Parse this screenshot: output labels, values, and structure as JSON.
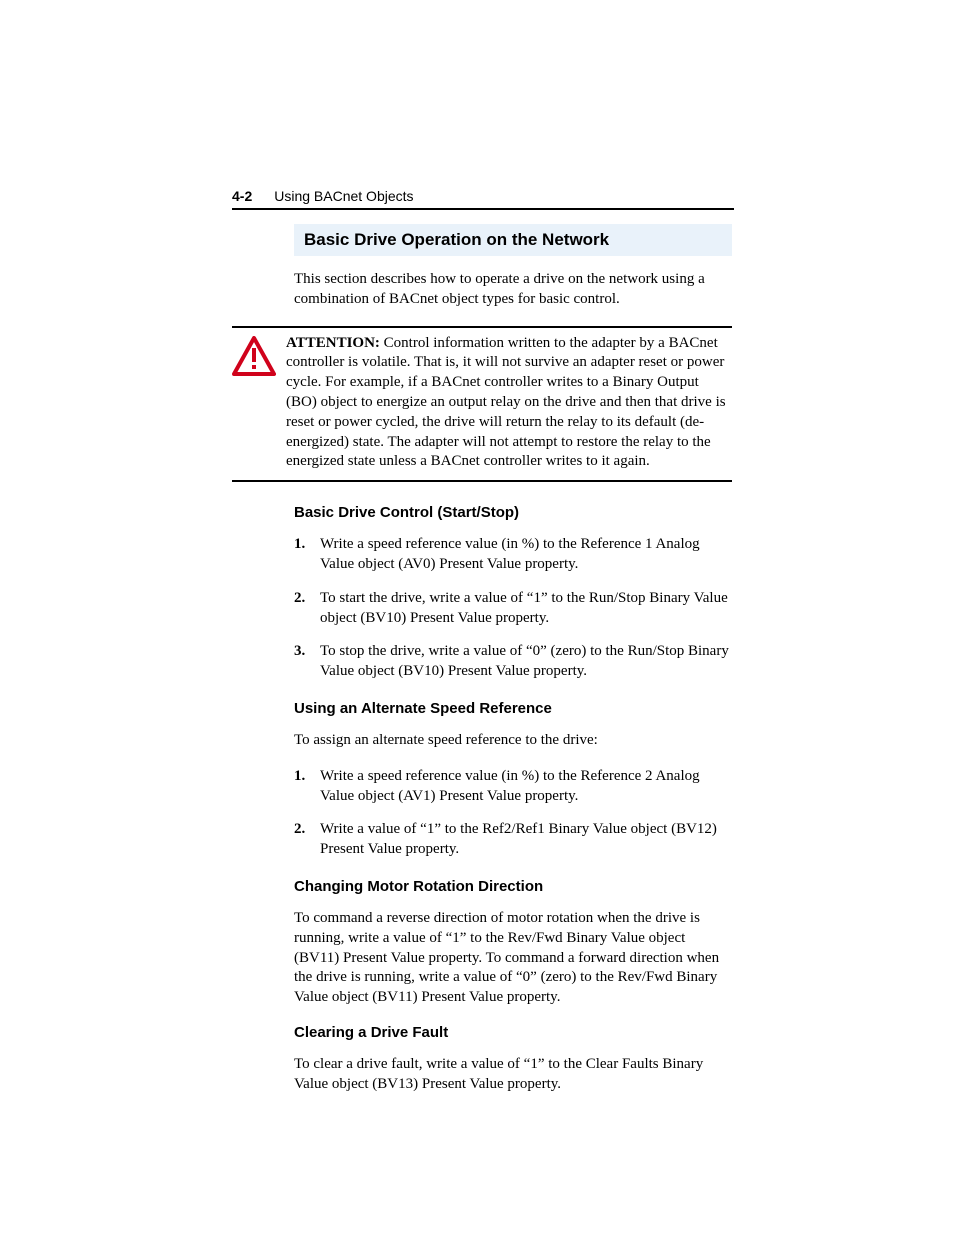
{
  "header": {
    "page_number": "4-2",
    "chapter_title": "Using BACnet Objects"
  },
  "section_heading": "Basic Drive Operation on the Network",
  "intro": "This section describes how to operate a drive on the network using a combination of BACnet object types for basic control.",
  "attention_label": "ATTENTION:",
  "attention_body": "Control information written to the adapter by a BACnet controller is volatile. That is, it will not survive an adapter reset or power cycle. For example, if a BACnet controller writes to a Binary Output (BO) object to energize an output relay on the drive and then that drive is reset or power cycled, the drive will return the relay to its default (de-energized) state. The adapter will not attempt to restore the relay to the energized state unless a BACnet controller writes to it again.",
  "sub1_heading": "Basic Drive Control (Start/Stop)",
  "sub1_steps": [
    "Write a speed reference value (in %) to the Reference 1 Analog Value object (AV0) Present Value property.",
    "To start the drive, write a value of “1” to the Run/Stop Binary Value object (BV10) Present Value property.",
    "To stop the drive, write a value of “0” (zero) to the Run/Stop Binary Value object (BV10) Present Value property."
  ],
  "sub2_heading": "Using an Alternate Speed Reference",
  "sub2_intro": "To assign an alternate speed reference to the drive:",
  "sub2_steps": [
    "Write a speed reference value (in %) to the Reference 2 Analog Value object (AV1) Present Value property.",
    "Write a value of “1” to the Ref2/Ref1 Binary Value object (BV12) Present Value property."
  ],
  "sub3_heading": "Changing Motor Rotation Direction",
  "sub3_body": "To command a reverse direction of motor rotation when the drive is running, write a value of “1” to the Rev/Fwd Binary Value object (BV11) Present Value property. To command a forward direction when the drive is running, write a value of “0” (zero) to the Rev/Fwd Binary Value object (BV11) Present Value property.",
  "sub4_heading": "Clearing a Drive Fault",
  "sub4_body": "To clear a drive fault, write a value of “1” to the Clear Faults Binary Value object (BV13) Present Value property."
}
